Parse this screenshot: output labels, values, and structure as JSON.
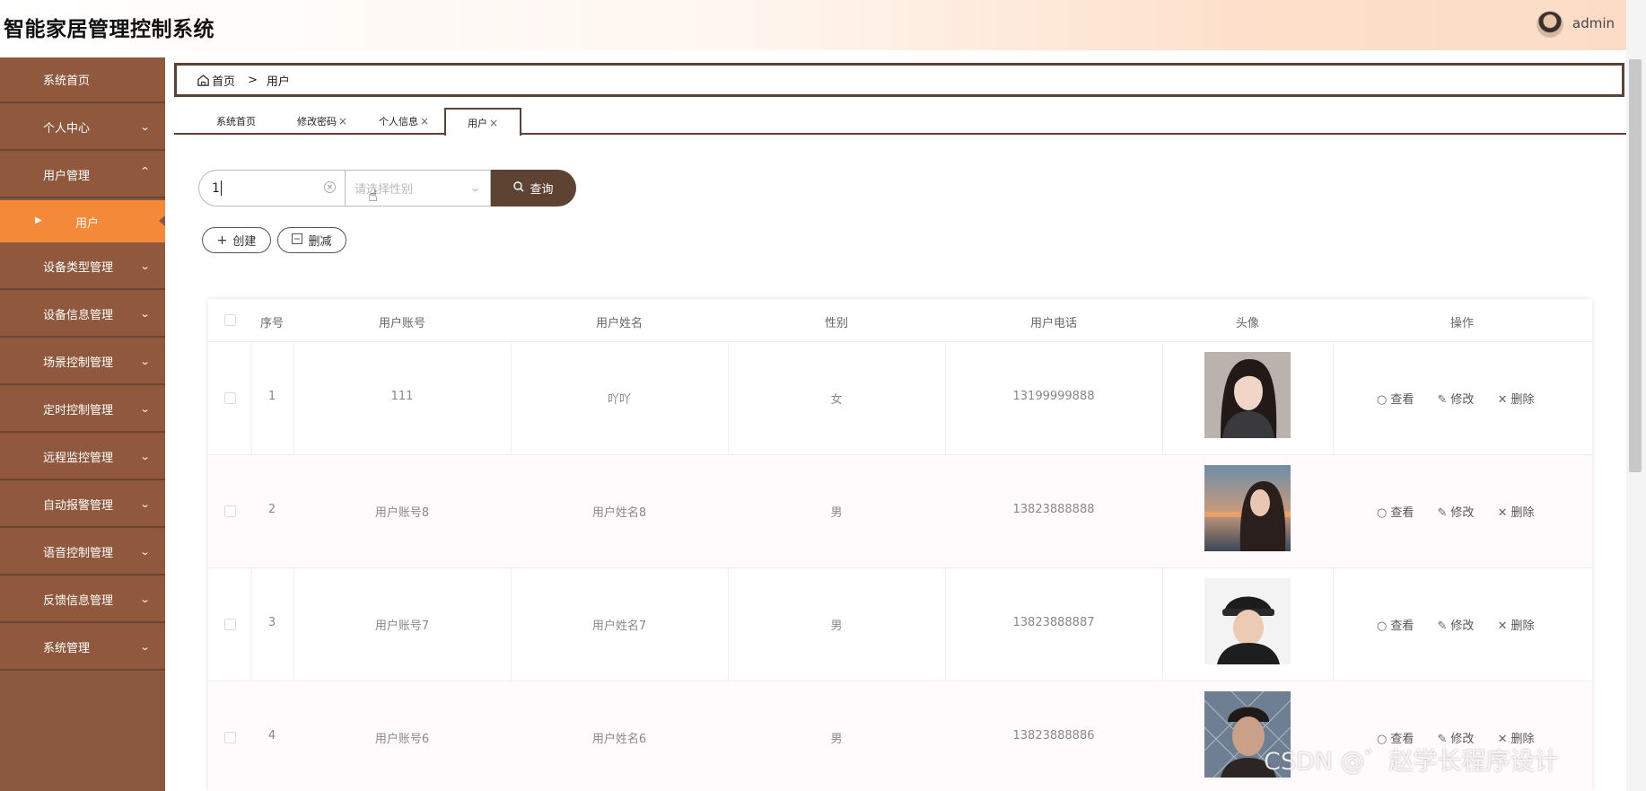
{
  "header": {
    "title": "智能家居管理控制系统",
    "username": "admin"
  },
  "sidebar": {
    "items": [
      {
        "label": "系统首页",
        "icon": "home-icon"
      },
      {
        "label": "个人中心",
        "icon": "card-icon"
      },
      {
        "label": "用户管理",
        "icon": "chart-icon"
      },
      {
        "label": "设备类型管理",
        "icon": "grid-icon"
      },
      {
        "label": "设备信息管理",
        "icon": "folder-icon"
      },
      {
        "label": "场景控制管理",
        "icon": "grid-icon"
      },
      {
        "label": "定时控制管理",
        "icon": "table-icon"
      },
      {
        "label": "远程监控管理",
        "icon": "grid-icon"
      },
      {
        "label": "自动报警管理",
        "icon": "person-icon"
      },
      {
        "label": "语音控制管理",
        "icon": "grid-icon"
      },
      {
        "label": "反馈信息管理",
        "icon": "briefcase-icon"
      },
      {
        "label": "系统管理",
        "icon": "clipboard-icon"
      }
    ],
    "sub_item": "用户"
  },
  "breadcrumb": {
    "home": "首页",
    "separator": ">",
    "current": "用户"
  },
  "tabs": [
    {
      "label": "系统首页",
      "closable": false
    },
    {
      "label": "修改密码",
      "closable": true
    },
    {
      "label": "个人信息",
      "closable": true
    },
    {
      "label": "用户",
      "closable": true,
      "active": true
    }
  ],
  "tab_close": "×",
  "search": {
    "value": "1",
    "gender_placeholder": "请选择性别",
    "query_label": "查询"
  },
  "actions": {
    "create_label": "创建",
    "delete_label": "删减"
  },
  "table": {
    "headers": [
      "序号",
      "用户账号",
      "用户姓名",
      "性别",
      "用户电话",
      "头像",
      "操作"
    ],
    "rows": [
      {
        "index": "1",
        "account": "111",
        "name": "吖吖",
        "gender": "女",
        "phone": "13199999888"
      },
      {
        "index": "2",
        "account": "用户账号8",
        "name": "用户姓名8",
        "gender": "男",
        "phone": "13823888888"
      },
      {
        "index": "3",
        "account": "用户账号7",
        "name": "用户姓名7",
        "gender": "男",
        "phone": "13823888887"
      },
      {
        "index": "4",
        "account": "用户账号6",
        "name": "用户姓名6",
        "gender": "男",
        "phone": "13823888886"
      }
    ],
    "ops": {
      "view": "查看",
      "edit": "修改",
      "delete": "删除"
    }
  },
  "watermark": "CSDN @゛赵学长程序设计",
  "colors": {
    "sidebar": "#8a583f",
    "sidebar_active": "#f48a39",
    "accent": "#5e4333"
  }
}
